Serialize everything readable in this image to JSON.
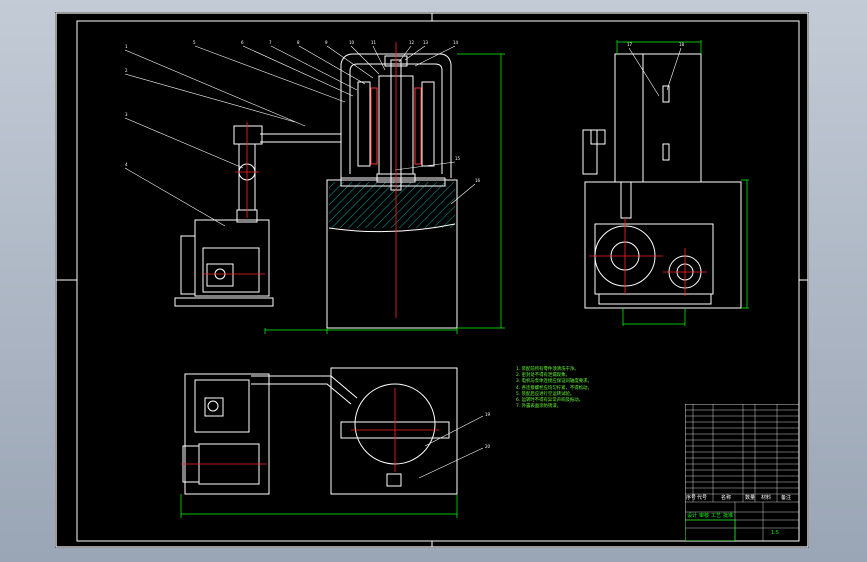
{
  "window": {
    "title": ""
  },
  "colors": {
    "viewport_bg": "#b3bcc9",
    "sheet_bg": "#000000",
    "outline": "#ffffff",
    "dimension": "#00ff00",
    "centerline": "#ff0000",
    "hatch": "#00ffff",
    "notes": "#66ff33"
  },
  "notes": {
    "lines": [
      "1. 装配前所有零件须清洗干净。",
      "2. 密封处不得有泄漏现象。",
      "3. 电机与泵体连接应保证同轴度要求。",
      "4. 各连接螺栓应均匀拧紧，不得松动。",
      "5. 装配后应进行空运转试验。",
      "6. 运转时不得有异常声响及振动。",
      "7. 外露表面涂防锈漆。"
    ]
  },
  "title_block": {
    "header": [
      "序号",
      "代号",
      "名称",
      "数量",
      "材料",
      "备注"
    ],
    "footer_labels": [
      "设计",
      "审核",
      "工艺",
      "批准"
    ],
    "scale": "1:5"
  }
}
